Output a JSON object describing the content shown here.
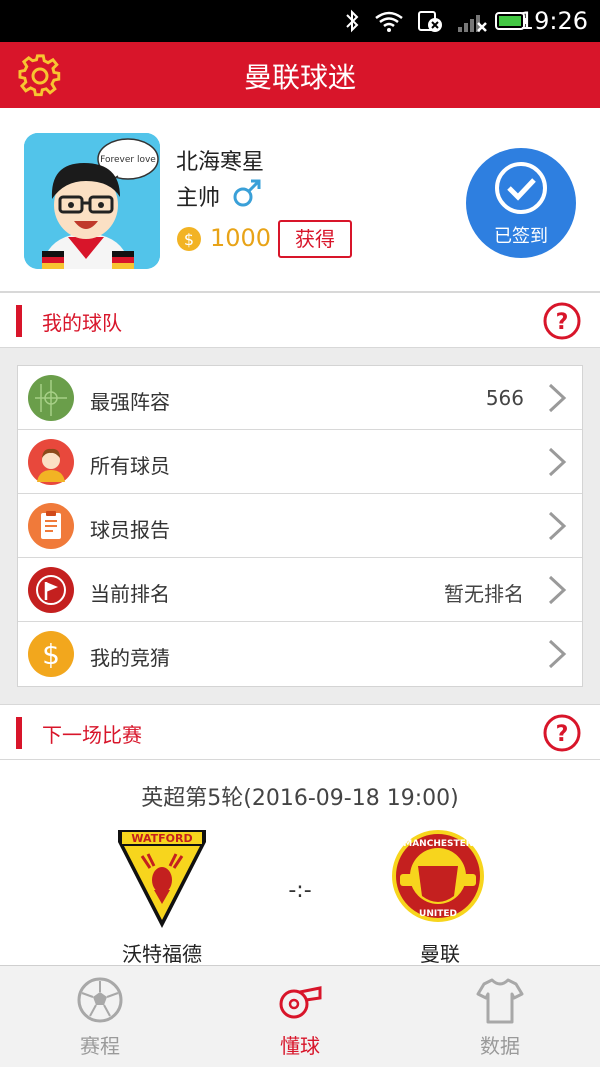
{
  "statusbar": {
    "time": "19:26"
  },
  "header": {
    "title": "曼联球迷"
  },
  "profile": {
    "nickname": "北海寒星",
    "role": "主帅",
    "coins": "1000",
    "get_label": "获得",
    "checkin_label": "已签到",
    "avatar_text": "Forever love"
  },
  "my_team": {
    "title": "我的球队",
    "items": [
      {
        "label": "最强阵容",
        "value": "566",
        "icon": "pitch-icon"
      },
      {
        "label": "所有球员",
        "value": "",
        "icon": "player-icon"
      },
      {
        "label": "球员报告",
        "value": "",
        "icon": "report-icon"
      },
      {
        "label": "当前排名",
        "value": "暂无排名",
        "icon": "flag-icon"
      },
      {
        "label": "我的竞猜",
        "value": "",
        "icon": "dollar-icon"
      }
    ]
  },
  "next_match": {
    "title": "下一场比赛",
    "round": "英超第5轮(2016-09-18 19:00)",
    "home": "沃特福德",
    "away": "曼联",
    "score": "-:-",
    "home_logo_text": "WATFORD",
    "away_logo_text_top": "MANCHESTER",
    "away_logo_text_bottom": "UNITED"
  },
  "nav": {
    "tabs": [
      {
        "label": "赛程",
        "icon": "football-icon",
        "active": false
      },
      {
        "label": "懂球",
        "icon": "whistle-icon",
        "active": true
      },
      {
        "label": "数据",
        "icon": "jersey-icon",
        "active": false
      }
    ]
  },
  "colors": {
    "brand": "#d8152a",
    "checkin": "#2e7fe0",
    "coin": "#e8a317"
  }
}
